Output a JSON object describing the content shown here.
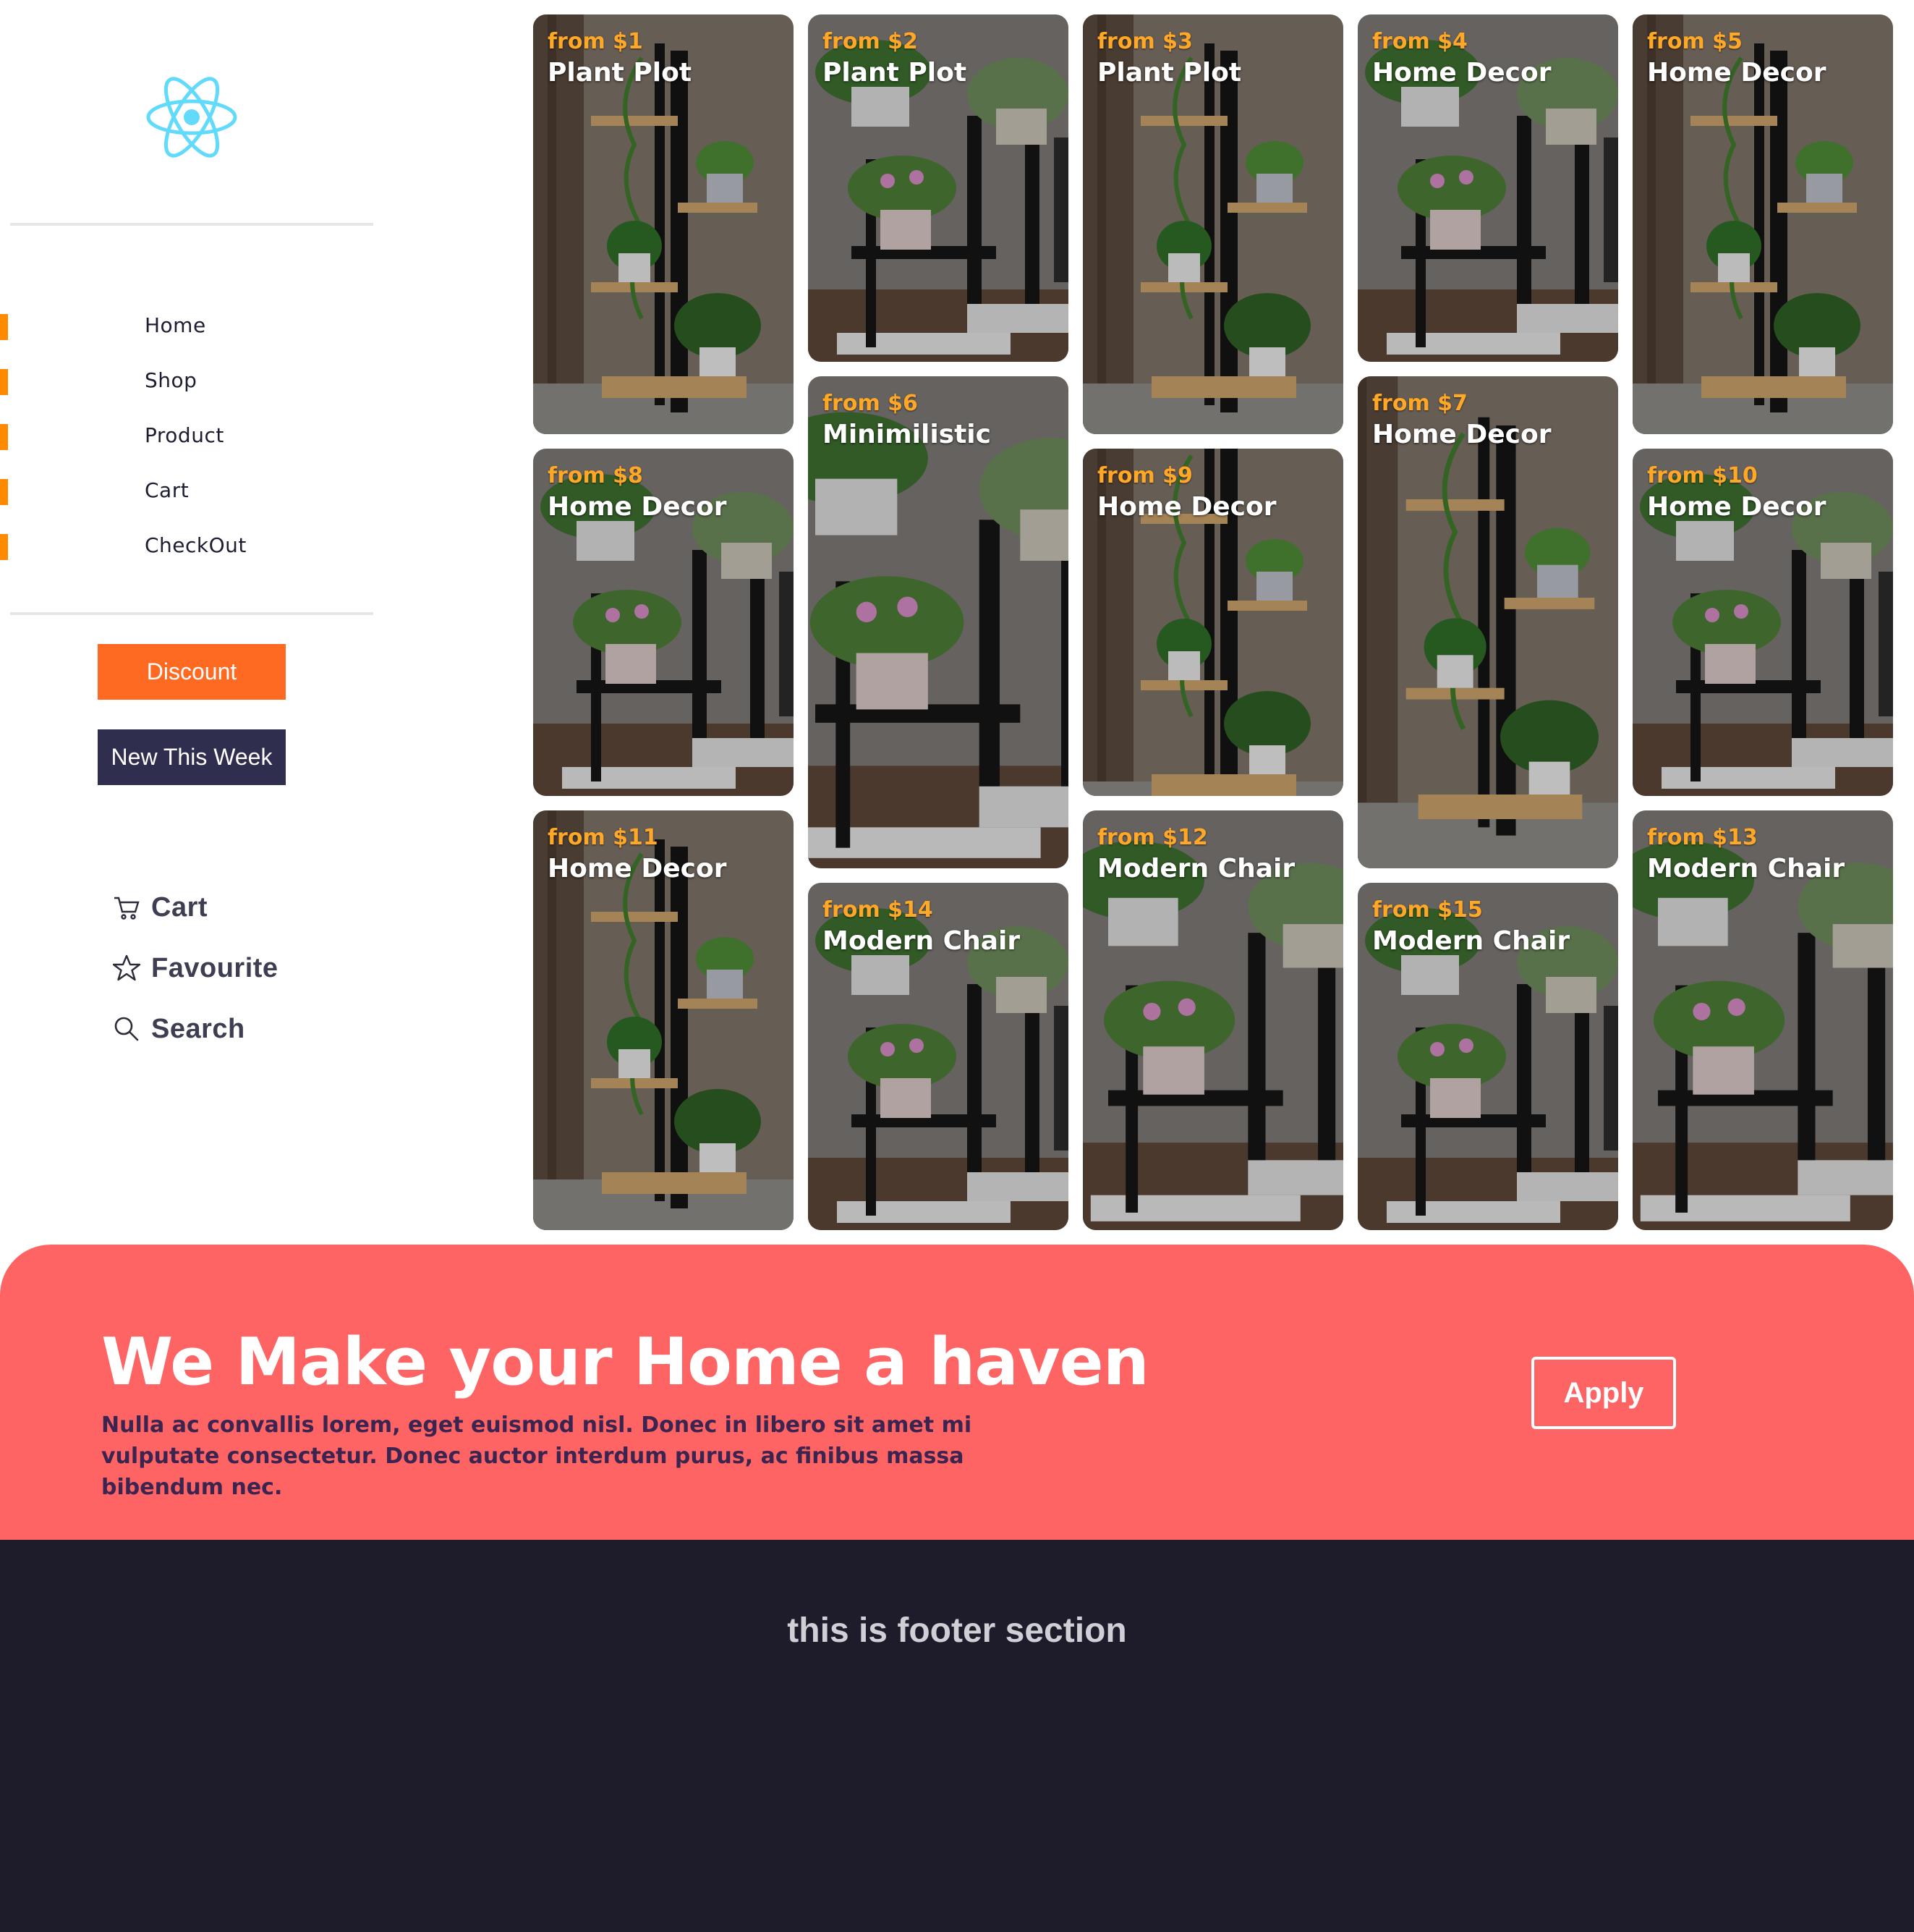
{
  "sidebar": {
    "logo_icon": "react-atom-icon",
    "nav": [
      {
        "label": "Home"
      },
      {
        "label": "Shop"
      },
      {
        "label": "Product"
      },
      {
        "label": "Cart"
      },
      {
        "label": "CheckOut"
      }
    ],
    "discount_label": "Discount",
    "new_week_label": "New This Week",
    "links": [
      {
        "label": "Cart",
        "icon": "cart-icon"
      },
      {
        "label": "Favourite",
        "icon": "star-icon"
      },
      {
        "label": "Search",
        "icon": "search-icon"
      }
    ]
  },
  "products": [
    {
      "price": "from $1",
      "name": "Plant Plot"
    },
    {
      "price": "from $2",
      "name": "Plant Plot"
    },
    {
      "price": "from $3",
      "name": "Plant Plot"
    },
    {
      "price": "from $4",
      "name": "Home Decor"
    },
    {
      "price": "from $5",
      "name": "Home Decor"
    },
    {
      "price": "from $6",
      "name": "Minimilistic"
    },
    {
      "price": "from $7",
      "name": "Home Decor"
    },
    {
      "price": "from $8",
      "name": "Home Decor"
    },
    {
      "price": "from $9",
      "name": "Home Decor"
    },
    {
      "price": "from $10",
      "name": "Home Decor"
    },
    {
      "price": "from $11",
      "name": "Home Decor"
    },
    {
      "price": "from $12",
      "name": "Modern Chair"
    },
    {
      "price": "from $13",
      "name": "Modern Chair"
    },
    {
      "price": "from $14",
      "name": "Modern Chair"
    },
    {
      "price": "from $15",
      "name": "Modern Chair"
    }
  ],
  "banner": {
    "headline": "We Make your Home a haven",
    "body": "Nulla ac convallis lorem, eget euismod nisl. Donec in libero sit amet mi vulputate consectetur. Donec auctor interdum purus, ac finibus massa bibendum nec.",
    "apply_label": "Apply"
  },
  "footer": {
    "text": "this is footer section"
  },
  "colors": {
    "accent_orange": "#ff8a00",
    "discount": "#ff6a23",
    "navy": "#2f2e4f",
    "banner": "#ff6464",
    "footer": "#1e1c2b",
    "price": "#ffa726"
  }
}
